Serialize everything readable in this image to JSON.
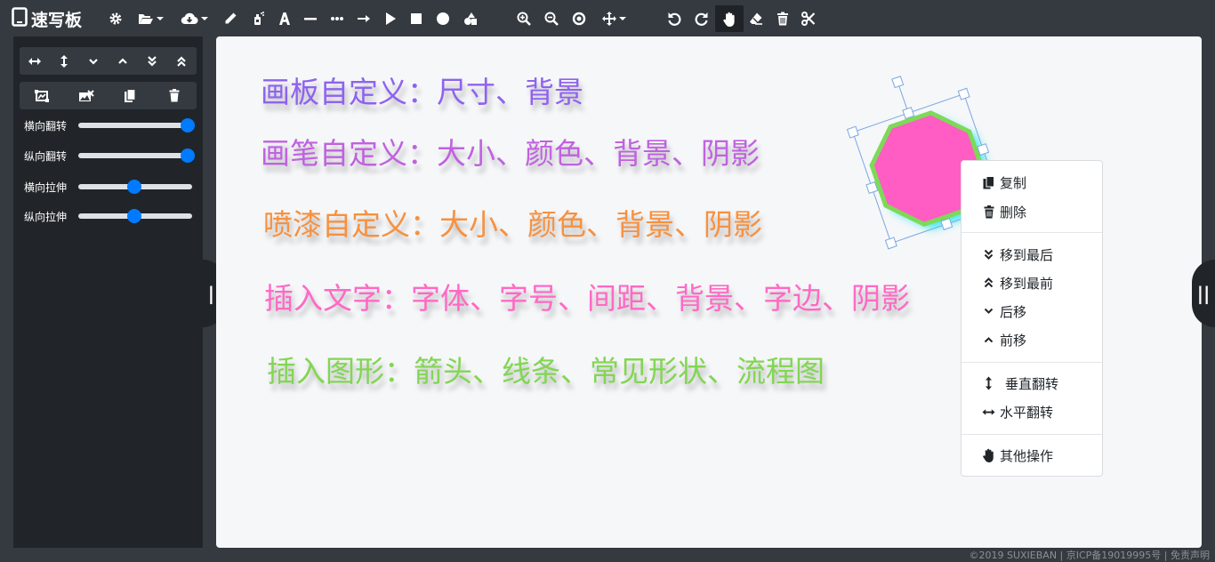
{
  "app": {
    "title": "速写板"
  },
  "toolbar": {
    "icons": [
      "settings-icon",
      "folder-open-icon",
      "cloud-download-icon",
      "pen-icon",
      "spray-icon",
      "text-icon",
      "line-icon",
      "dotted-line-icon",
      "arrow-icon",
      "triangle-icon",
      "square-icon",
      "circle-icon",
      "shapes-icon",
      "zoom-in-icon",
      "zoom-out-icon",
      "zoom-reset-icon",
      "move-icon",
      "undo-icon",
      "redo-icon",
      "hand-icon",
      "eraser-icon",
      "trash-icon",
      "cut-icon"
    ],
    "active": "hand-icon"
  },
  "left_panel": {
    "order_buttons": [
      "flip-horizontal-icon",
      "flip-vertical-icon",
      "move-down-icon",
      "move-up-icon",
      "move-to-bottom-icon",
      "move-to-top-icon"
    ],
    "action_buttons": [
      "crop-icon",
      "image-remove-icon",
      "copy-icon",
      "delete-icon"
    ],
    "sliders": [
      {
        "label": "横向翻转",
        "value": 1.0
      },
      {
        "label": "纵向翻转",
        "value": 1.0
      },
      {
        "label": "横向拉伸",
        "value": 0.5
      },
      {
        "label": "纵向拉伸",
        "value": 0.5
      }
    ]
  },
  "canvas": {
    "lines": [
      {
        "text": "画板自定义：尺寸、背景",
        "color": "#8f62f0"
      },
      {
        "text": "画笔自定义：大小、颜色、背景、阴影",
        "color": "#c062e0"
      },
      {
        "text": "喷漆自定义：大小、颜色、背景、阴影",
        "color": "#f7913f"
      },
      {
        "text": "插入文字：字体、字号、间距、背景、字边、阴影",
        "color": "#ff69c5"
      },
      {
        "text": "插入图形：箭头、线条、常见形状、流程图",
        "color": "#82d653"
      }
    ],
    "shape": {
      "type": "octagon",
      "fill": "#ff5cc4",
      "stroke": "#7ed957"
    }
  },
  "context_menu": {
    "copy": "复制",
    "delete": "删除",
    "move_to_last": "移到最后",
    "move_to_front": "移到最前",
    "move_back": "后移",
    "move_forward": "前移",
    "flip_vertical": "垂直翻转",
    "flip_horizontal": "水平翻转",
    "other": "其他操作"
  },
  "footer": {
    "text": "©2019 SUXIEBAN | 京ICP备19019995号 | 免责声明"
  },
  "colors": {
    "accent": "#007bff",
    "toolbar": "#343a40",
    "panel": "#212529",
    "canvas": "#f6f7f9"
  }
}
